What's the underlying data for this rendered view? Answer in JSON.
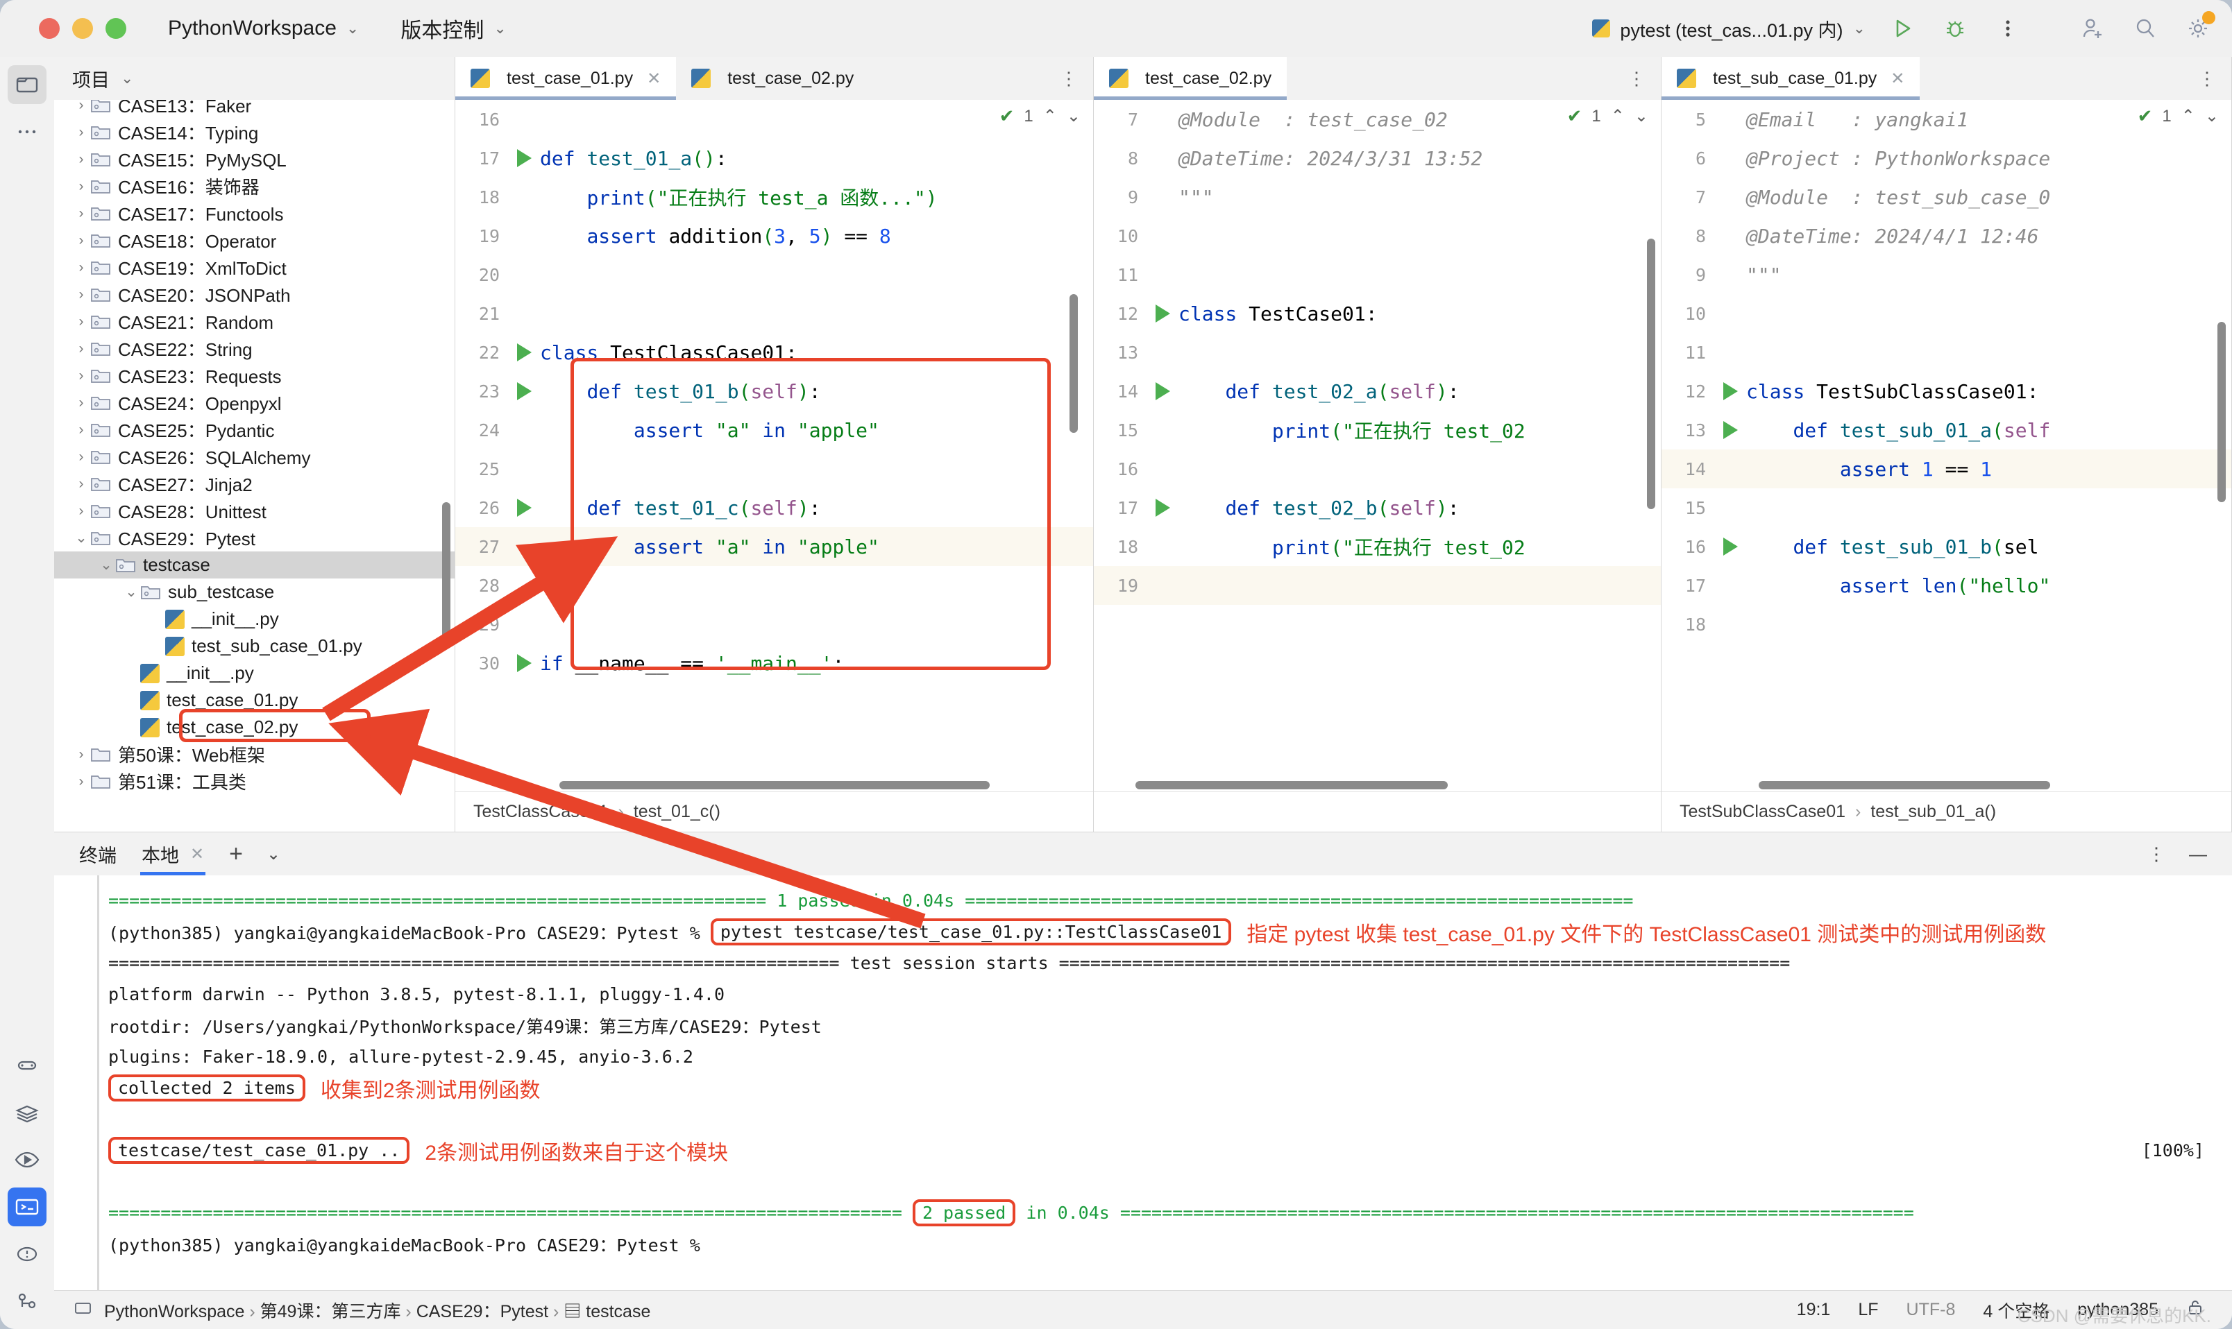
{
  "titlebar": {
    "project_name": "PythonWorkspace",
    "vcs_label": "版本控制",
    "run_config": "pytest (test_cas...01.py 内)",
    "icons": [
      "run-icon",
      "debug-icon",
      "more-icon",
      "add-user-icon",
      "search-icon",
      "settings-icon"
    ]
  },
  "project_panel": {
    "title": "项目",
    "tree": [
      {
        "label": "CASE13：Faker",
        "type": "folder",
        "depth": 1,
        "expanded": false,
        "clipped": true
      },
      {
        "label": "CASE14：Typing",
        "type": "folder",
        "depth": 1,
        "expanded": false
      },
      {
        "label": "CASE15：PyMySQL",
        "type": "folder",
        "depth": 1,
        "expanded": false
      },
      {
        "label": "CASE16：装饰器",
        "type": "folder",
        "depth": 1,
        "expanded": false
      },
      {
        "label": "CASE17：Functools",
        "type": "folder",
        "depth": 1,
        "expanded": false
      },
      {
        "label": "CASE18：Operator",
        "type": "folder",
        "depth": 1,
        "expanded": false
      },
      {
        "label": "CASE19：XmlToDict",
        "type": "folder",
        "depth": 1,
        "expanded": false
      },
      {
        "label": "CASE20：JSONPath",
        "type": "folder",
        "depth": 1,
        "expanded": false
      },
      {
        "label": "CASE21：Random",
        "type": "folder",
        "depth": 1,
        "expanded": false
      },
      {
        "label": "CASE22：String",
        "type": "folder",
        "depth": 1,
        "expanded": false
      },
      {
        "label": "CASE23：Requests",
        "type": "folder",
        "depth": 1,
        "expanded": false
      },
      {
        "label": "CASE24：Openpyxl",
        "type": "folder",
        "depth": 1,
        "expanded": false
      },
      {
        "label": "CASE25：Pydantic",
        "type": "folder",
        "depth": 1,
        "expanded": false
      },
      {
        "label": "CASE26：SQLAlchemy",
        "type": "folder",
        "depth": 1,
        "expanded": false
      },
      {
        "label": "CASE27：Jinja2",
        "type": "folder",
        "depth": 1,
        "expanded": false
      },
      {
        "label": "CASE28：Unittest",
        "type": "folder",
        "depth": 1,
        "expanded": false
      },
      {
        "label": "CASE29：Pytest",
        "type": "folder",
        "depth": 1,
        "expanded": true
      },
      {
        "label": "testcase",
        "type": "folder",
        "depth": 2,
        "expanded": true,
        "selected": true
      },
      {
        "label": "sub_testcase",
        "type": "folder",
        "depth": 3,
        "expanded": true
      },
      {
        "label": "__init__.py",
        "type": "python",
        "depth": 4
      },
      {
        "label": "test_sub_case_01.py",
        "type": "python",
        "depth": 4
      },
      {
        "label": "__init__.py",
        "type": "python",
        "depth": 3
      },
      {
        "label": "test_case_01.py",
        "type": "python",
        "depth": 3,
        "highlighted": true
      },
      {
        "label": "test_case_02.py",
        "type": "python",
        "depth": 3
      },
      {
        "label": "第50课：Web框架",
        "type": "folder",
        "depth": 1,
        "expanded": false
      },
      {
        "label": "第51课：工具类",
        "type": "folder",
        "depth": 1,
        "expanded": false
      }
    ]
  },
  "editors": [
    {
      "tabs": [
        {
          "label": "test_case_01.py",
          "active": true,
          "closable": true
        },
        {
          "label": "test_case_02.py",
          "active": false,
          "closable": false
        }
      ],
      "inspection": "1",
      "lines": [
        {
          "num": "16",
          "text": "",
          "runmark": false,
          "clipped": true
        },
        {
          "num": "17",
          "text": "def test_01_a():",
          "runmark": true
        },
        {
          "num": "18",
          "text": "    print(\"正在执行 test_a 函数...\")",
          "runmark": false
        },
        {
          "num": "19",
          "text": "    assert addition(3, 5) == 8",
          "runmark": false
        },
        {
          "num": "20",
          "text": "",
          "runmark": false
        },
        {
          "num": "21",
          "text": "",
          "runmark": false
        },
        {
          "num": "22",
          "text": "class TestClassCase01:",
          "runmark": true
        },
        {
          "num": "23",
          "text": "    def test_01_b(self):",
          "runmark": true
        },
        {
          "num": "24",
          "text": "        assert \"a\" in \"apple\"",
          "runmark": false
        },
        {
          "num": "25",
          "text": "",
          "runmark": false
        },
        {
          "num": "26",
          "text": "    def test_01_c(self):",
          "runmark": true
        },
        {
          "num": "27",
          "text": "        assert \"a\" in \"apple\"",
          "runmark": false,
          "highlight": true
        },
        {
          "num": "28",
          "text": "",
          "runmark": false
        },
        {
          "num": "29",
          "text": "",
          "runmark": false
        },
        {
          "num": "30",
          "text": "if __name__ == '__main__':",
          "runmark": true
        }
      ],
      "breadcrumb": [
        "TestClassCase01",
        "test_01_c()"
      ]
    },
    {
      "tabs": [
        {
          "label": "test_case_02.py",
          "active": true,
          "closable": false
        }
      ],
      "inspection": "1",
      "lines": [
        {
          "num": "7",
          "text": "@Module  : test_case_02",
          "comment": true
        },
        {
          "num": "8",
          "text": "@DateTime: 2024/3/31 13:52",
          "comment": true
        },
        {
          "num": "9",
          "text": "\"\"\"",
          "comment": true
        },
        {
          "num": "10",
          "text": ""
        },
        {
          "num": "11",
          "text": ""
        },
        {
          "num": "12",
          "text": "class TestCase01:",
          "runmark": true
        },
        {
          "num": "13",
          "text": ""
        },
        {
          "num": "14",
          "text": "    def test_02_a(self):",
          "runmark": true
        },
        {
          "num": "15",
          "text": "        print(\"正在执行 test_02"
        },
        {
          "num": "16",
          "text": ""
        },
        {
          "num": "17",
          "text": "    def test_02_b(self):",
          "runmark": true
        },
        {
          "num": "18",
          "text": "        print(\"正在执行 test_02"
        },
        {
          "num": "19",
          "text": "",
          "highlight": true
        }
      ],
      "breadcrumb": []
    },
    {
      "tabs": [
        {
          "label": "test_sub_case_01.py",
          "active": true,
          "closable": true
        }
      ],
      "inspection": "1",
      "lines": [
        {
          "num": "5",
          "text": "@Email   : yangkai1",
          "comment": true
        },
        {
          "num": "6",
          "text": "@Project : PythonWorkspace",
          "comment": true
        },
        {
          "num": "7",
          "text": "@Module  : test_sub_case_0",
          "comment": true
        },
        {
          "num": "8",
          "text": "@DateTime: 2024/4/1 12:46",
          "comment": true
        },
        {
          "num": "9",
          "text": "\"\"\"",
          "comment": true
        },
        {
          "num": "10",
          "text": ""
        },
        {
          "num": "11",
          "text": ""
        },
        {
          "num": "12",
          "text": "class TestSubClassCase01:",
          "runmark": true
        },
        {
          "num": "13",
          "text": "    def test_sub_01_a(self",
          "runmark": true
        },
        {
          "num": "14",
          "text": "        assert 1 == 1",
          "highlight": true
        },
        {
          "num": "15",
          "text": ""
        },
        {
          "num": "16",
          "text": "    def test_sub_01_b(sel",
          "runmark": true
        },
        {
          "num": "17",
          "text": "        assert len(\"hello\""
        },
        {
          "num": "18",
          "text": ""
        }
      ],
      "breadcrumb": [
        "TestSubClassCase01",
        "test_sub_01_a()"
      ]
    }
  ],
  "terminal": {
    "title": "终端",
    "tab_label": "本地",
    "add_label": "+",
    "lines": [
      {
        "kind": "sep-green",
        "text": "=============================================================== 1 passed in 0.04s ================================================================"
      },
      {
        "kind": "prompt",
        "prefix": "(python385) yangkai@yangkaideMacBook-Pro CASE29：Pytest % ",
        "command": "pytest testcase/test_case_01.py::TestClassCase01",
        "note": "指定 pytest 收集 test_case_01.py 文件下的 TestClassCase01 测试类中的测试用例函数"
      },
      {
        "kind": "sep-black",
        "text": "====================================================================== test session starts ======================================================================"
      },
      {
        "kind": "plain",
        "text": "platform darwin -- Python 3.8.5, pytest-8.1.1, pluggy-1.4.0"
      },
      {
        "kind": "plain",
        "text": "rootdir: /Users/yangkai/PythonWorkspace/第49课：第三方库/CASE29：Pytest"
      },
      {
        "kind": "plain",
        "text": "plugins: Faker-18.9.0, allure-pytest-2.9.45, anyio-3.6.2"
      },
      {
        "kind": "boxed",
        "text": "collected 2 items",
        "note": "收集到2条测试用例函数"
      },
      {
        "kind": "blank",
        "text": ""
      },
      {
        "kind": "boxed-pct",
        "text": "testcase/test_case_01.py ..",
        "note": "2条测试用例函数来自于这个模块",
        "pct": "[100%]"
      },
      {
        "kind": "blank",
        "text": ""
      },
      {
        "kind": "sep-green-boxed",
        "left": "============================================================================ ",
        "boxed": "2 passed",
        "right": " in 0.04s ============================================================================"
      },
      {
        "kind": "prompt-end",
        "text": "(python385) yangkai@yangkaideMacBook-Pro CASE29：Pytest %"
      }
    ]
  },
  "statusbar": {
    "breadcrumb": [
      "PythonWorkspace",
      "第49课：第三方库",
      "CASE29：Pytest",
      "testcase"
    ],
    "caret": "19:1",
    "line_sep": "LF",
    "encoding": "UTF-8",
    "indent": "4 个空格",
    "interpreter": "python385",
    "watermark": "CSDN @需要休息的KK."
  }
}
